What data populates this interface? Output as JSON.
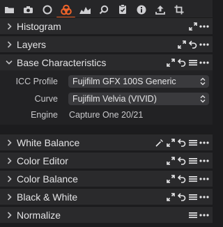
{
  "toolbar": {
    "icons": [
      "folder-icon",
      "camera-icon",
      "circle-icon",
      "color-icon",
      "histogram-icon",
      "search-icon",
      "clipboard-check-icon",
      "info-icon",
      "upload-icon",
      "crop-icon"
    ],
    "active_icon": "color-icon",
    "accent": "#f0642a"
  },
  "panels": [
    {
      "title": "Histogram",
      "expanded": false,
      "actions": [
        "expand",
        "more"
      ]
    },
    {
      "title": "Layers",
      "expanded": false,
      "actions": [
        "expand",
        "reset",
        "more"
      ]
    },
    {
      "title": "Base Characteristics",
      "expanded": true,
      "actions": [
        "expand",
        "reset",
        "menu",
        "more"
      ]
    },
    {
      "title": "White Balance",
      "expanded": false,
      "actions": [
        "picker",
        "expand",
        "reset",
        "menu",
        "more"
      ]
    },
    {
      "title": "Color Editor",
      "expanded": false,
      "actions": [
        "expand",
        "reset",
        "menu",
        "more"
      ]
    },
    {
      "title": "Color Balance",
      "expanded": false,
      "actions": [
        "expand",
        "reset",
        "menu",
        "more"
      ]
    },
    {
      "title": "Black & White",
      "expanded": false,
      "actions": [
        "expand",
        "reset",
        "menu",
        "more"
      ]
    },
    {
      "title": "Normalize",
      "expanded": false,
      "actions": [
        "menu",
        "more"
      ]
    }
  ],
  "base": {
    "icc_label": "ICC Profile",
    "icc_value": "Fujifilm GFX 100S Generic",
    "curve_label": "Curve",
    "curve_value": "Fujifilm Velvia (VIVID)",
    "engine_label": "Engine",
    "engine_value": "Capture One 20/21"
  }
}
